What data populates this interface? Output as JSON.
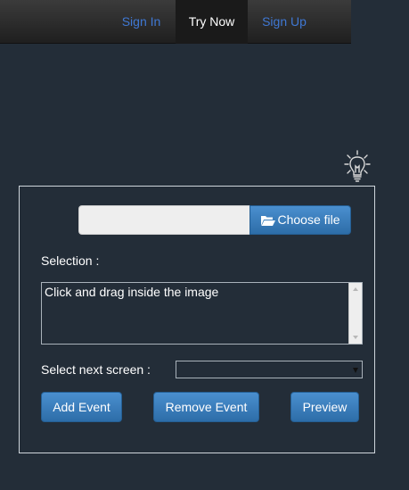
{
  "nav": {
    "sign_in": "Sign In",
    "try_now": "Try Now",
    "sign_up": "Sign Up"
  },
  "form": {
    "choose_file_label": "Choose file",
    "selection_label": "Selection :",
    "selection_placeholder": "Click and drag inside the image",
    "next_screen_label": "Select next screen :",
    "next_screen_value": ""
  },
  "buttons": {
    "add_event": "Add Event",
    "remove_event": "Remove Event",
    "preview": "Preview"
  },
  "colors": {
    "background": "#232d38",
    "link": "#3f78d4",
    "button": "#337ab7"
  },
  "icons": {
    "bulb": "lightbulb-icon",
    "folder": "folder-open-icon"
  }
}
